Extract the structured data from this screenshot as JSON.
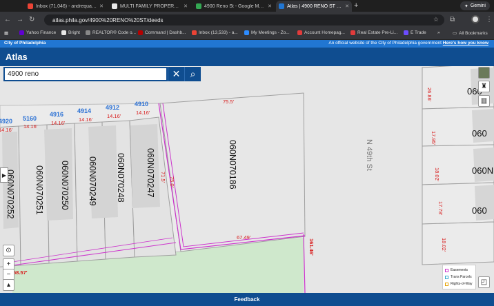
{
  "browser": {
    "tabs": [
      {
        "label": "Inbox (71,046) - andrequain...",
        "color": "#ea4335"
      },
      {
        "label": "MULTI FAMILY PROPERTIES ...",
        "color": "#e8e8e8"
      },
      {
        "label": "4900 Reno St - Google Maps",
        "color": "#34a853"
      },
      {
        "label": "Atlas | 4900 RENO ST | deeds",
        "color": "#2176d2"
      }
    ],
    "gemini_label": "Gemini",
    "url": "atlas.phila.gov/4900%20RENO%20ST/deeds",
    "bookmarks": [
      {
        "label": "Yahoo Finance",
        "color": "#6001d2"
      },
      {
        "label": "Bright",
        "color": "#e8e8e8"
      },
      {
        "label": "REALTOR® Code o...",
        "color": "#888888"
      },
      {
        "label": "Command | Dashb...",
        "color": "#b40101"
      },
      {
        "label": "Inbox (13,533) - a...",
        "color": "#ea4335"
      },
      {
        "label": "My Meetings - Zo...",
        "color": "#2d8cff"
      },
      {
        "label": "Account Homepag...",
        "color": "#e23b3b"
      },
      {
        "label": "Real Estate Pre-Li...",
        "color": "#e23b3b"
      },
      {
        "label": "E Trade",
        "color": "#6b4cff"
      }
    ],
    "all_bookmarks": "All Bookmarks"
  },
  "city_banner": {
    "left": "City of Philadelphia",
    "right": "An official website of the City of Philadelphia government",
    "link": "Here's how you know"
  },
  "app": {
    "title": "Atlas",
    "search_value": "4900 reno",
    "feedback": "Feedback"
  },
  "map": {
    "address_labels": [
      "4920",
      "5160",
      "4916",
      "4914",
      "4912",
      "4910"
    ],
    "frontage_labels": [
      "14.16'",
      "14.16'",
      "14.16'",
      "14.16'",
      "14.16'",
      "14.16'"
    ],
    "parcels": [
      "060N070252",
      "060N070251",
      "060N070250",
      "060N070249",
      "060N070248",
      "060N070247",
      "060N070186"
    ],
    "right_parcels": [
      "060",
      "060",
      "060N",
      "060"
    ],
    "street": "N 49th St",
    "dims": {
      "top": "75.5'",
      "bottom": "67.49'",
      "side_left": "71.5'",
      "side_inner": "75.0'",
      "right_side": "161.46'",
      "corner": "58.57'"
    },
    "right_dims": [
      "26.86'",
      "17.95'",
      "18.02'",
      "17.78'",
      "18.02'"
    ],
    "legend": [
      {
        "label": "Easements",
        "color": "#cc33cc"
      },
      {
        "label": "Trans Parcels",
        "color": "#33aacc"
      },
      {
        "label": "Rights-of-Way",
        "color": "#e6a100"
      }
    ]
  }
}
